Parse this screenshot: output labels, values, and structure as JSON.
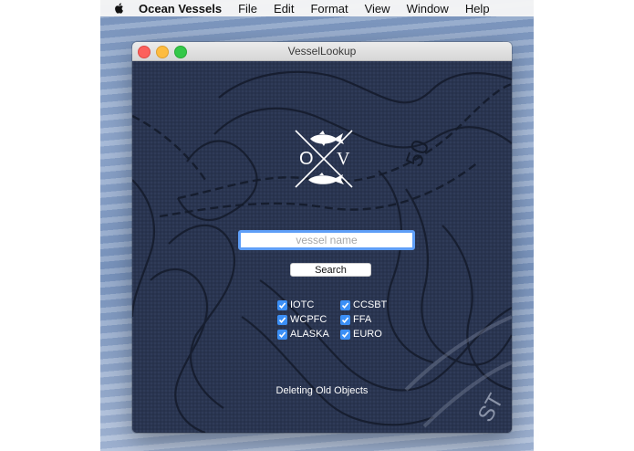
{
  "menubar": {
    "app_name": "Ocean Vessels",
    "items": [
      "File",
      "Edit",
      "Format",
      "View",
      "Window",
      "Help"
    ]
  },
  "window": {
    "title": "VesselLookup"
  },
  "logo": {
    "left_letter": "O",
    "right_letter": "V"
  },
  "search": {
    "placeholder": "vessel name",
    "value": "",
    "button_label": "Search"
  },
  "checkboxes": [
    {
      "label": "IOTC",
      "checked": true
    },
    {
      "label": "CCSBT",
      "checked": true
    },
    {
      "label": "WCPFC",
      "checked": true
    },
    {
      "label": "FFA",
      "checked": true
    },
    {
      "label": "ALASKA",
      "checked": true
    },
    {
      "label": "EURO",
      "checked": true
    }
  ],
  "map": {
    "contour_labels": [
      "50",
      "ST"
    ]
  },
  "status": {
    "text": "Deleting Old Objects"
  },
  "colors": {
    "map_background": "#2a3550",
    "accent": "#3b8ff6",
    "focus_ring": "#5e9ef7"
  }
}
